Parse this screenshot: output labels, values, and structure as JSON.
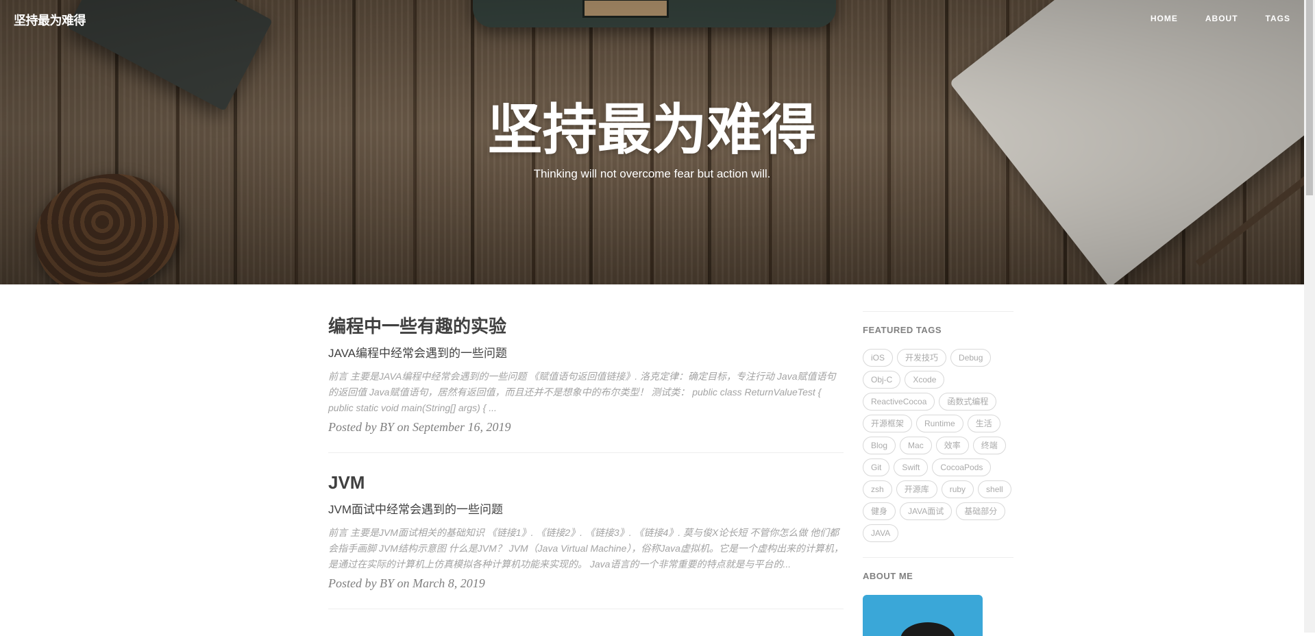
{
  "nav": {
    "brand": "坚持最为难得",
    "links": [
      "HOME",
      "ABOUT",
      "TAGS"
    ]
  },
  "hero": {
    "title": "坚持最为难得",
    "subtitle": "Thinking will not overcome fear but action will."
  },
  "posts": [
    {
      "title": "编程中一些有趣的实验",
      "subtitle": "JAVA编程中经常会遇到的一些问题",
      "excerpt": "前言 主要是JAVA编程中经常会遇到的一些问题 《赋值语句返回值链接》. 洛克定律：确定目标，专注行动 Java赋值语句的返回值 Java赋值语句，居然有返回值，而且还并不是想象中的布尔类型！ 测试类： public class ReturnValueTest { public static void main(String[] args) { ...",
      "meta": "Posted by BY on September 16, 2019"
    },
    {
      "title": "JVM",
      "subtitle": "JVM面试中经常会遇到的一些问题",
      "excerpt": "前言 主要是JVM面试相关的基础知识 《链接1》. 《链接2》. 《链接3》. 《链接4》. 莫与俊X论长短 不管你怎么做 他们都会指手画脚 JVM结构示意图 什么是JVM？ JVM（Java Virtual Machine），俗称Java虚拟机。它是一个虚构出来的计算机， 是通过在实际的计算机上仿真模拟各种计算机功能来实现的。 Java语言的一个非常重要的特点就是与平台的...",
      "meta": "Posted by BY on March 8, 2019"
    }
  ],
  "sidebar": {
    "featured_heading": "FEATURED TAGS",
    "tags": [
      "iOS",
      "开发技巧",
      "Debug",
      "Obj-C",
      "Xcode",
      "ReactiveCocoa",
      "函数式编程",
      "开源框架",
      "Runtime",
      "生活",
      "Blog",
      "Mac",
      "效率",
      "终端",
      "Git",
      "Swift",
      "CocoaPods",
      "zsh",
      "开源库",
      "ruby",
      "shell",
      "健身",
      "JAVA面试",
      "基础部分",
      "JAVA"
    ],
    "about_heading": "ABOUT ME"
  }
}
